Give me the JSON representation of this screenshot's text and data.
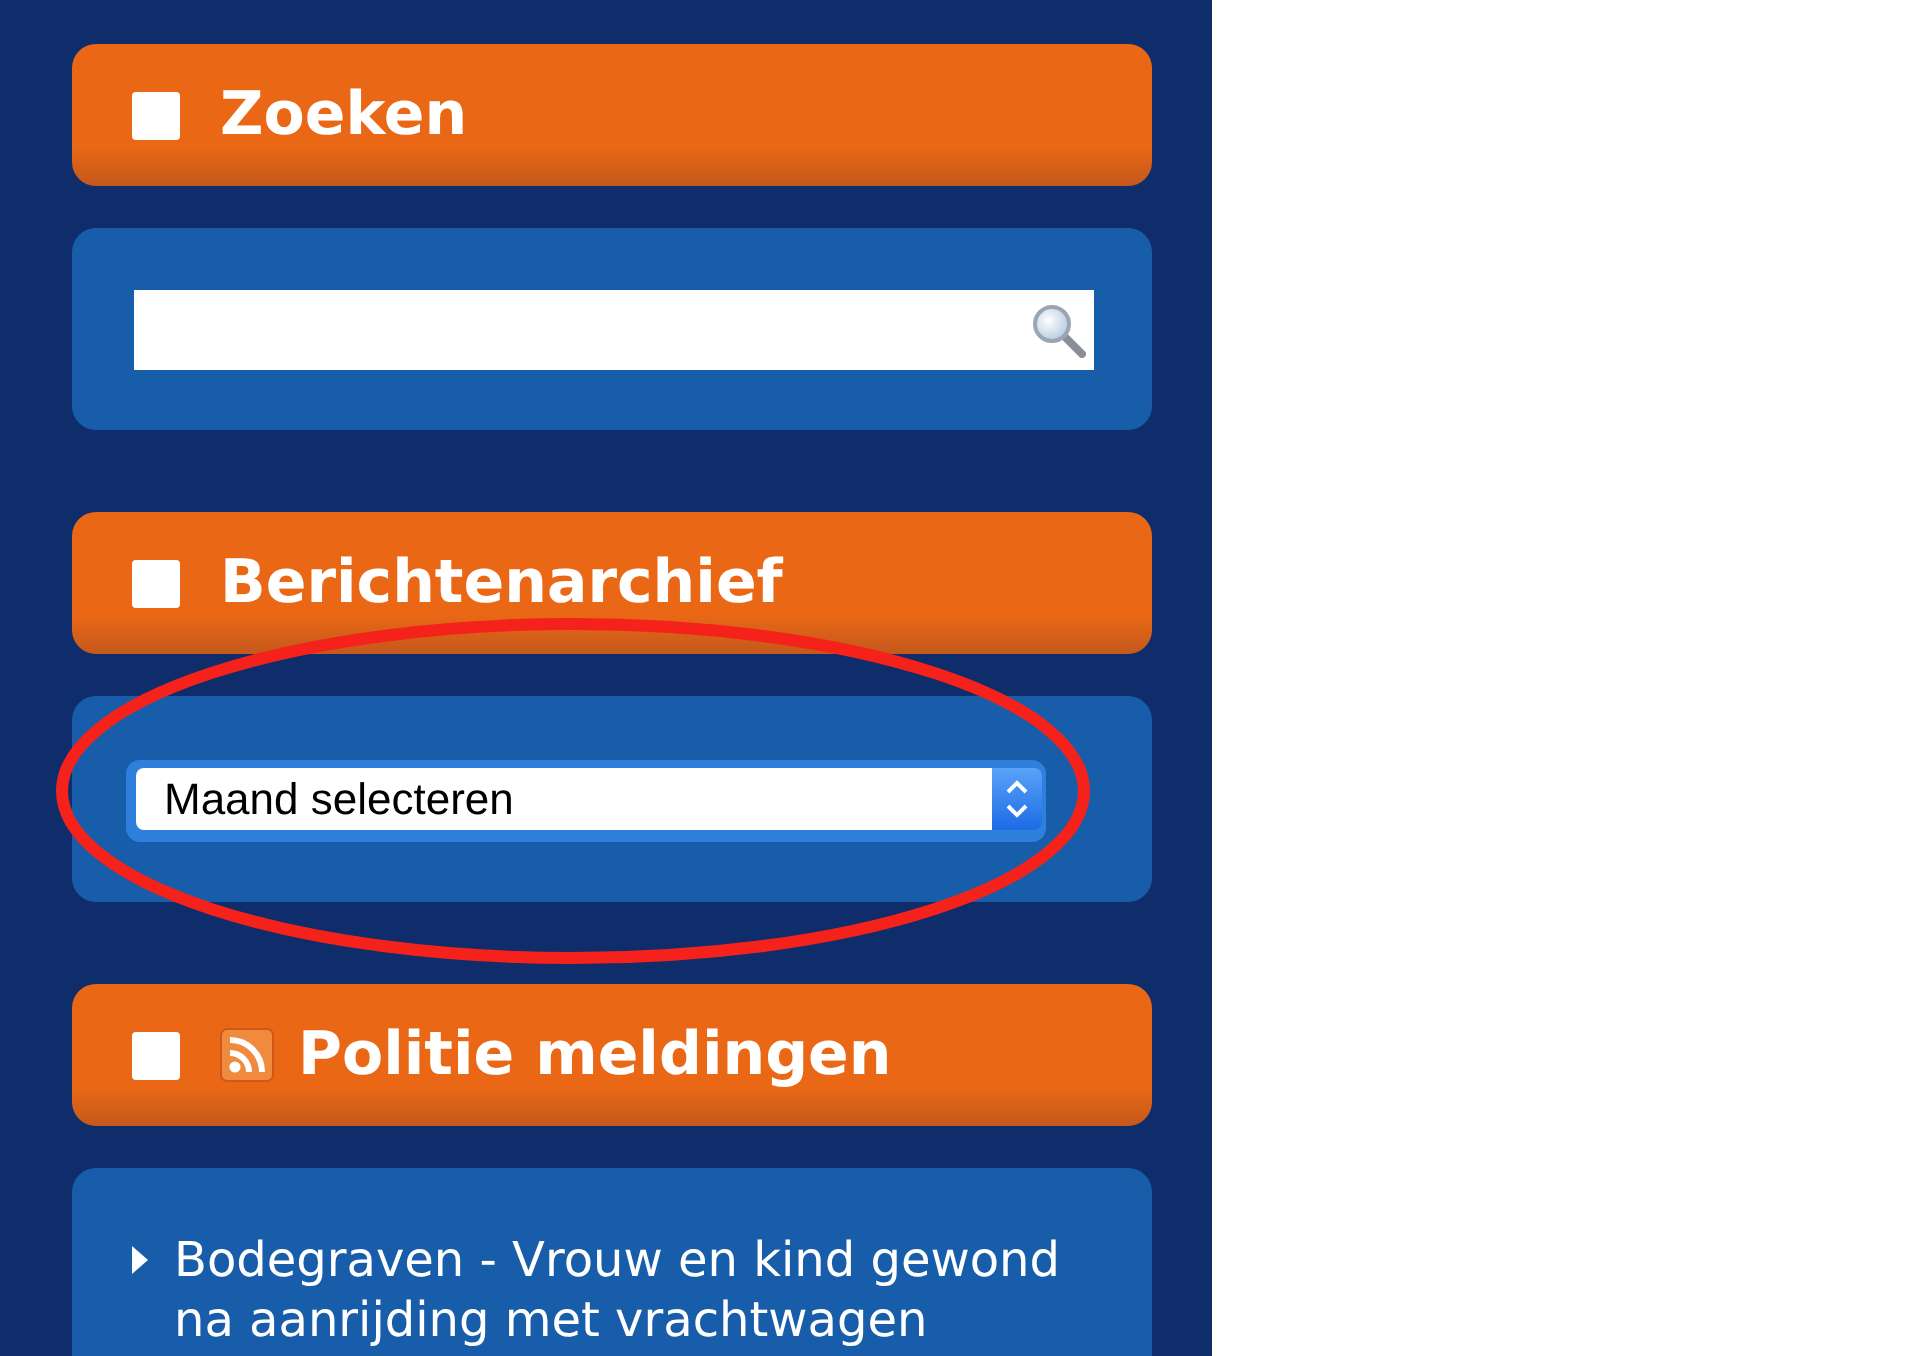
{
  "sidebar": {
    "widgets": [
      {
        "kind": "search",
        "title": "Zoeken"
      },
      {
        "kind": "archive",
        "title": "Berichtenarchief",
        "select": {
          "value": "Maand selecteren"
        },
        "highlighted": true
      },
      {
        "kind": "feed",
        "title": "Politie meldingen",
        "items": [
          "Bodegraven - Vrouw en kind gewond na aanrijding met vrachtwagen"
        ]
      }
    ]
  }
}
